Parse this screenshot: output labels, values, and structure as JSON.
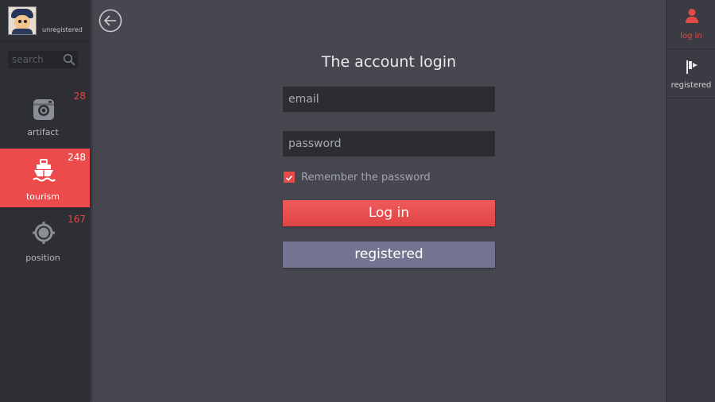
{
  "profile": {
    "username": "unregistered",
    "avatar_icon": "avatar-icon"
  },
  "search": {
    "placeholder": "search",
    "icon": "search-icon"
  },
  "nav": {
    "items": [
      {
        "label": "artifact",
        "badge": "28",
        "icon": "camera-icon",
        "active": false
      },
      {
        "label": "tourism",
        "badge": "248",
        "icon": "ship-icon",
        "active": true
      },
      {
        "label": "position",
        "badge": "167",
        "icon": "target-icon",
        "active": false
      }
    ]
  },
  "main": {
    "back_icon": "back-arrow-icon",
    "title": "The account login",
    "email": {
      "placeholder": "email",
      "value": ""
    },
    "password": {
      "placeholder": "password",
      "value": ""
    },
    "remember": {
      "label": "Remember the password",
      "checked": true
    },
    "login_label": "Log in",
    "register_label": "registered"
  },
  "rightbar": {
    "items": [
      {
        "label": "log in",
        "icon": "user-icon",
        "active": true
      },
      {
        "label": "registered",
        "icon": "flag-icon",
        "active": false
      }
    ]
  },
  "colors": {
    "accent": "#ec4b4b",
    "sidebar_bg": "#2e2f35",
    "main_bg": "#45464f",
    "register_button": "#737590"
  }
}
